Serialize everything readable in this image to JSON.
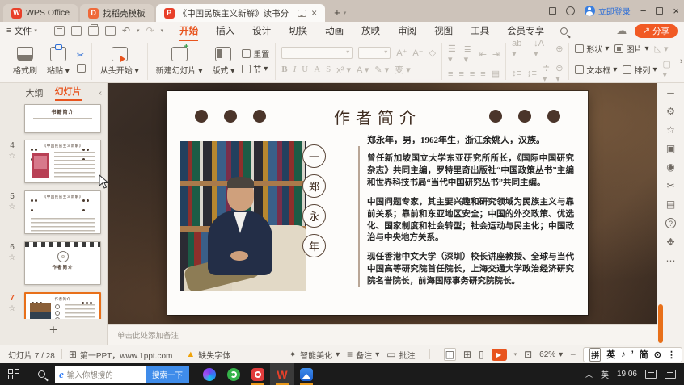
{
  "titlebar": {
    "tab_wps": "WPS Office",
    "tab_docer": "找稻壳模板",
    "tab_doc": "《中国民族主义新解》读书分",
    "login": "立即登录"
  },
  "menubar": {
    "file": "文件",
    "items": [
      "开始",
      "插入",
      "设计",
      "切换",
      "动画",
      "放映",
      "审阅",
      "视图",
      "工具",
      "会员专享"
    ],
    "share": "分享"
  },
  "toolbar": {
    "format_painter": "格式刷",
    "paste": "粘贴",
    "from_start": "从头开始",
    "new_slide": "新建幻灯片",
    "layout": "版式",
    "reset": "重置",
    "section": "节",
    "bold": "B",
    "italic": "I",
    "underline": "U",
    "strike": "S",
    "char_a": "A",
    "shapes": "形状",
    "pictures": "图片",
    "textbox": "文本框",
    "arrange": "排列"
  },
  "sidebar": {
    "tab_outline": "大纲",
    "tab_slides": "幻灯片",
    "partial_title": "书籍简介",
    "thumb4_title": "《中国民族主义新解》",
    "thumb5_title": "《中国民族主义新解》",
    "thumb6_title": "作者简介",
    "thumb7_title": "作者简介",
    "nums": [
      "4",
      "5",
      "6",
      "7"
    ],
    "star": "☆",
    "add": "+"
  },
  "slide": {
    "title": "作者简介",
    "circles": [
      "一",
      "郑",
      "永",
      "年"
    ],
    "intro": "郑永年，男，1962年生，浙江余姚人，汉族。",
    "paragraphs": [
      "曾任新加坡国立大学东亚研究所所长，《国际中国研究杂志》共同主编，罗特里奇出版社“中国政策丛书”主编和世界科技书局“当代中国研究丛书”共同主编。",
      "中国问题专家，其主要兴趣和研究领域为民族主义与靠前关系；靠前和东亚地区安全；中国的外交政策、优选化、国家制度和社会转型；社会运动与民主化；中国政治与中央地方关系。",
      "现任香港中文大学（深圳）校长讲座教授、全球与当代中国高等研究院首任院长，上海交通大学政治经济研究院名誉院长，前海国际事务研究院院长。"
    ]
  },
  "notes": {
    "placeholder": "单击此处添加备注"
  },
  "statusbar": {
    "slide_counter": "幻灯片 7 / 28",
    "brand": "第一PPT，www.1ppt.com",
    "missing_font": "缺失字体",
    "beautify": "智能美化",
    "notes_btn": "备注",
    "comment_btn": "批注",
    "zoom": "62%"
  },
  "ime": {
    "pin": "拼",
    "en": "英",
    "note": "♪",
    "tick": "’",
    "jian": "简",
    "circle": "⊙",
    "more": "⋮"
  },
  "taskbar": {
    "search_placeholder": "输入你想搜的",
    "search_button": "搜索一下",
    "lang": "英",
    "time": "19:06"
  },
  "colors": {
    "accent": "#e8541e",
    "login_blue": "#2f6fd6",
    "taskbar_search_blue": "#3f8cea"
  }
}
